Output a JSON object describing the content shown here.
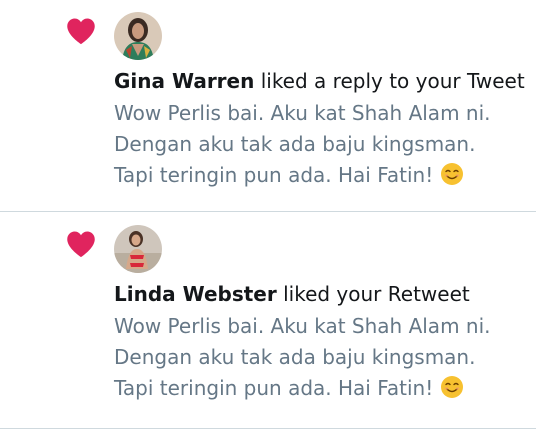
{
  "colors": {
    "heart": "#e0245e",
    "name_text": "#14171a",
    "tweet_text": "#657786",
    "divider": "#cfd9de"
  },
  "notifications": [
    {
      "icon": "heart-icon",
      "user_name": "Gina Warren",
      "action": " liked a reply to your Tweet",
      "tweet_lines": [
        "Wow Perlis bai. Aku kat Shah Alam ni.",
        "Dengan aku tak ada baju kingsman.",
        "Tapi teringin pun ada. Hai Fatin! "
      ],
      "emoji": "smiling-face-emoji"
    },
    {
      "icon": "heart-icon",
      "user_name": "Linda Webster",
      "action": " liked your Retweet",
      "tweet_lines": [
        "Wow Perlis bai. Aku kat Shah Alam ni.",
        "Dengan aku tak ada baju kingsman.",
        "Tapi teringin pun ada. Hai Fatin! "
      ],
      "emoji": "smiling-face-emoji"
    }
  ]
}
